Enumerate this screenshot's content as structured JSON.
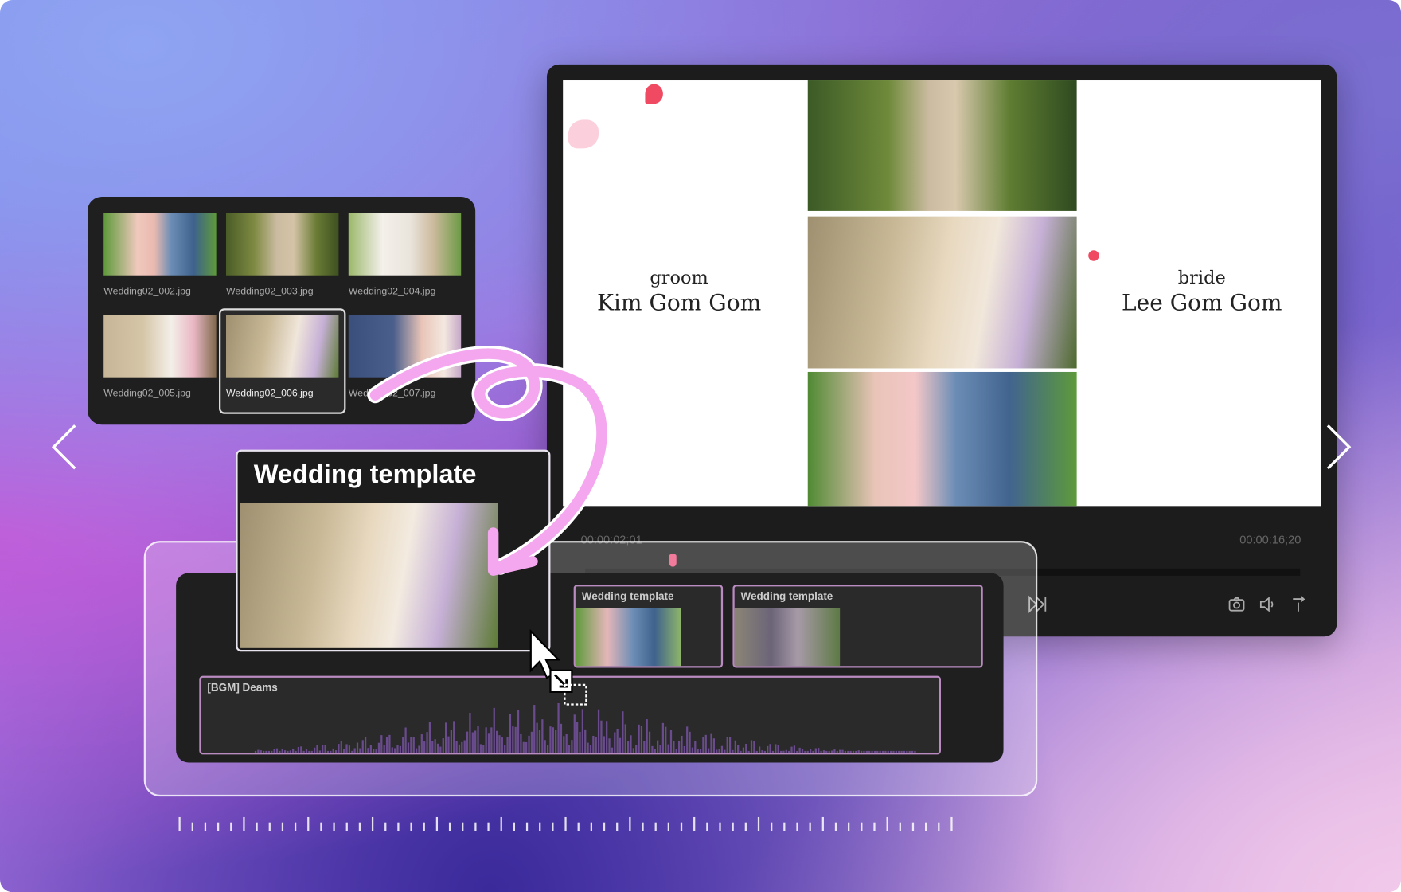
{
  "preview": {
    "groom_role": "groom",
    "groom_name": "Kim Gom Gom",
    "bride_role": "bride",
    "bride_name": "Lee Gom Gom",
    "current_time": "00:00:02;01",
    "total_time": "00:00:16;20",
    "playhead_progress": 0.125
  },
  "media": {
    "files": [
      "Wedding02_002.jpg",
      "Wedding02_003.jpg",
      "Wedding02_004.jpg",
      "Wedding02_005.jpg",
      "Wedding02_006.jpg",
      "Wedding02_007.jpg"
    ],
    "selected": "Wedding02_006.jpg"
  },
  "drag_card": {
    "title": "Wedding template"
  },
  "timeline": {
    "clips": [
      "Wedding template",
      "Wedding template"
    ],
    "audio": "[BGM] Deams"
  },
  "colors": {
    "accent": "#f4a6ee",
    "clip_border": "#b98bc0",
    "playhead": "#f27a9a"
  },
  "icons": [
    "chevron-left",
    "chevron-right",
    "skip-end",
    "camera",
    "volume",
    "share",
    "cursor",
    "drop-target"
  ]
}
